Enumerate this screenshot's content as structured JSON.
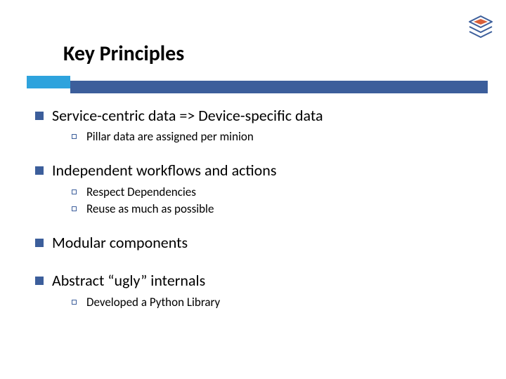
{
  "title": "Key Principles",
  "bullets": {
    "b0": {
      "text": "Service-centric data => Device-specific data",
      "sub": [
        "Pillar data are assigned per minion"
      ]
    },
    "b1": {
      "text": "Independent workflows and actions",
      "sub": [
        "Respect Dependencies",
        "Reuse as much as possible"
      ]
    },
    "b2": {
      "text": "Modular components",
      "sub": []
    },
    "b3": {
      "text": "Abstract “ugly” internals",
      "sub": [
        "Developed a Python Library"
      ]
    }
  }
}
